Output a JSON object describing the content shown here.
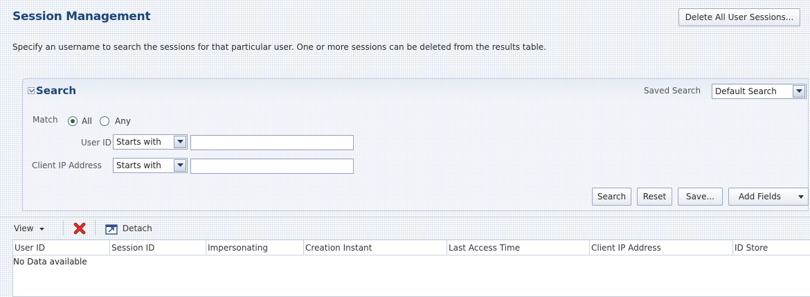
{
  "header": {
    "title": "Session Management",
    "delete_all_label": "Delete All User Sessions..."
  },
  "description": "Specify an username to search the sessions for that particular user. One or more sessions can be deleted from the results table.",
  "search": {
    "title": "Search",
    "saved_search_label": "Saved Search",
    "saved_search_value": "Default Search",
    "match_label": "Match",
    "match_options": [
      "All",
      "Any"
    ],
    "match_selected": "All",
    "fields": [
      {
        "label": "User ID",
        "operator": "Starts with",
        "value": ""
      },
      {
        "label": "Client IP Address",
        "operator": "Starts with",
        "value": ""
      }
    ],
    "buttons": {
      "search": "Search",
      "reset": "Reset",
      "save": "Save...",
      "add_fields": "Add Fields"
    }
  },
  "toolbar": {
    "view_label": "View",
    "delete_icon": "red-x-delete-icon",
    "detach_label": "Detach"
  },
  "table": {
    "columns": [
      "User ID",
      "Session ID",
      "Impersonating",
      "Creation Instant",
      "Last Access Time",
      "Client IP Address",
      "ID Store"
    ],
    "empty_text": "No Data available"
  },
  "colors": {
    "title": "#1d4477",
    "delete_icon": "#d9231f"
  }
}
